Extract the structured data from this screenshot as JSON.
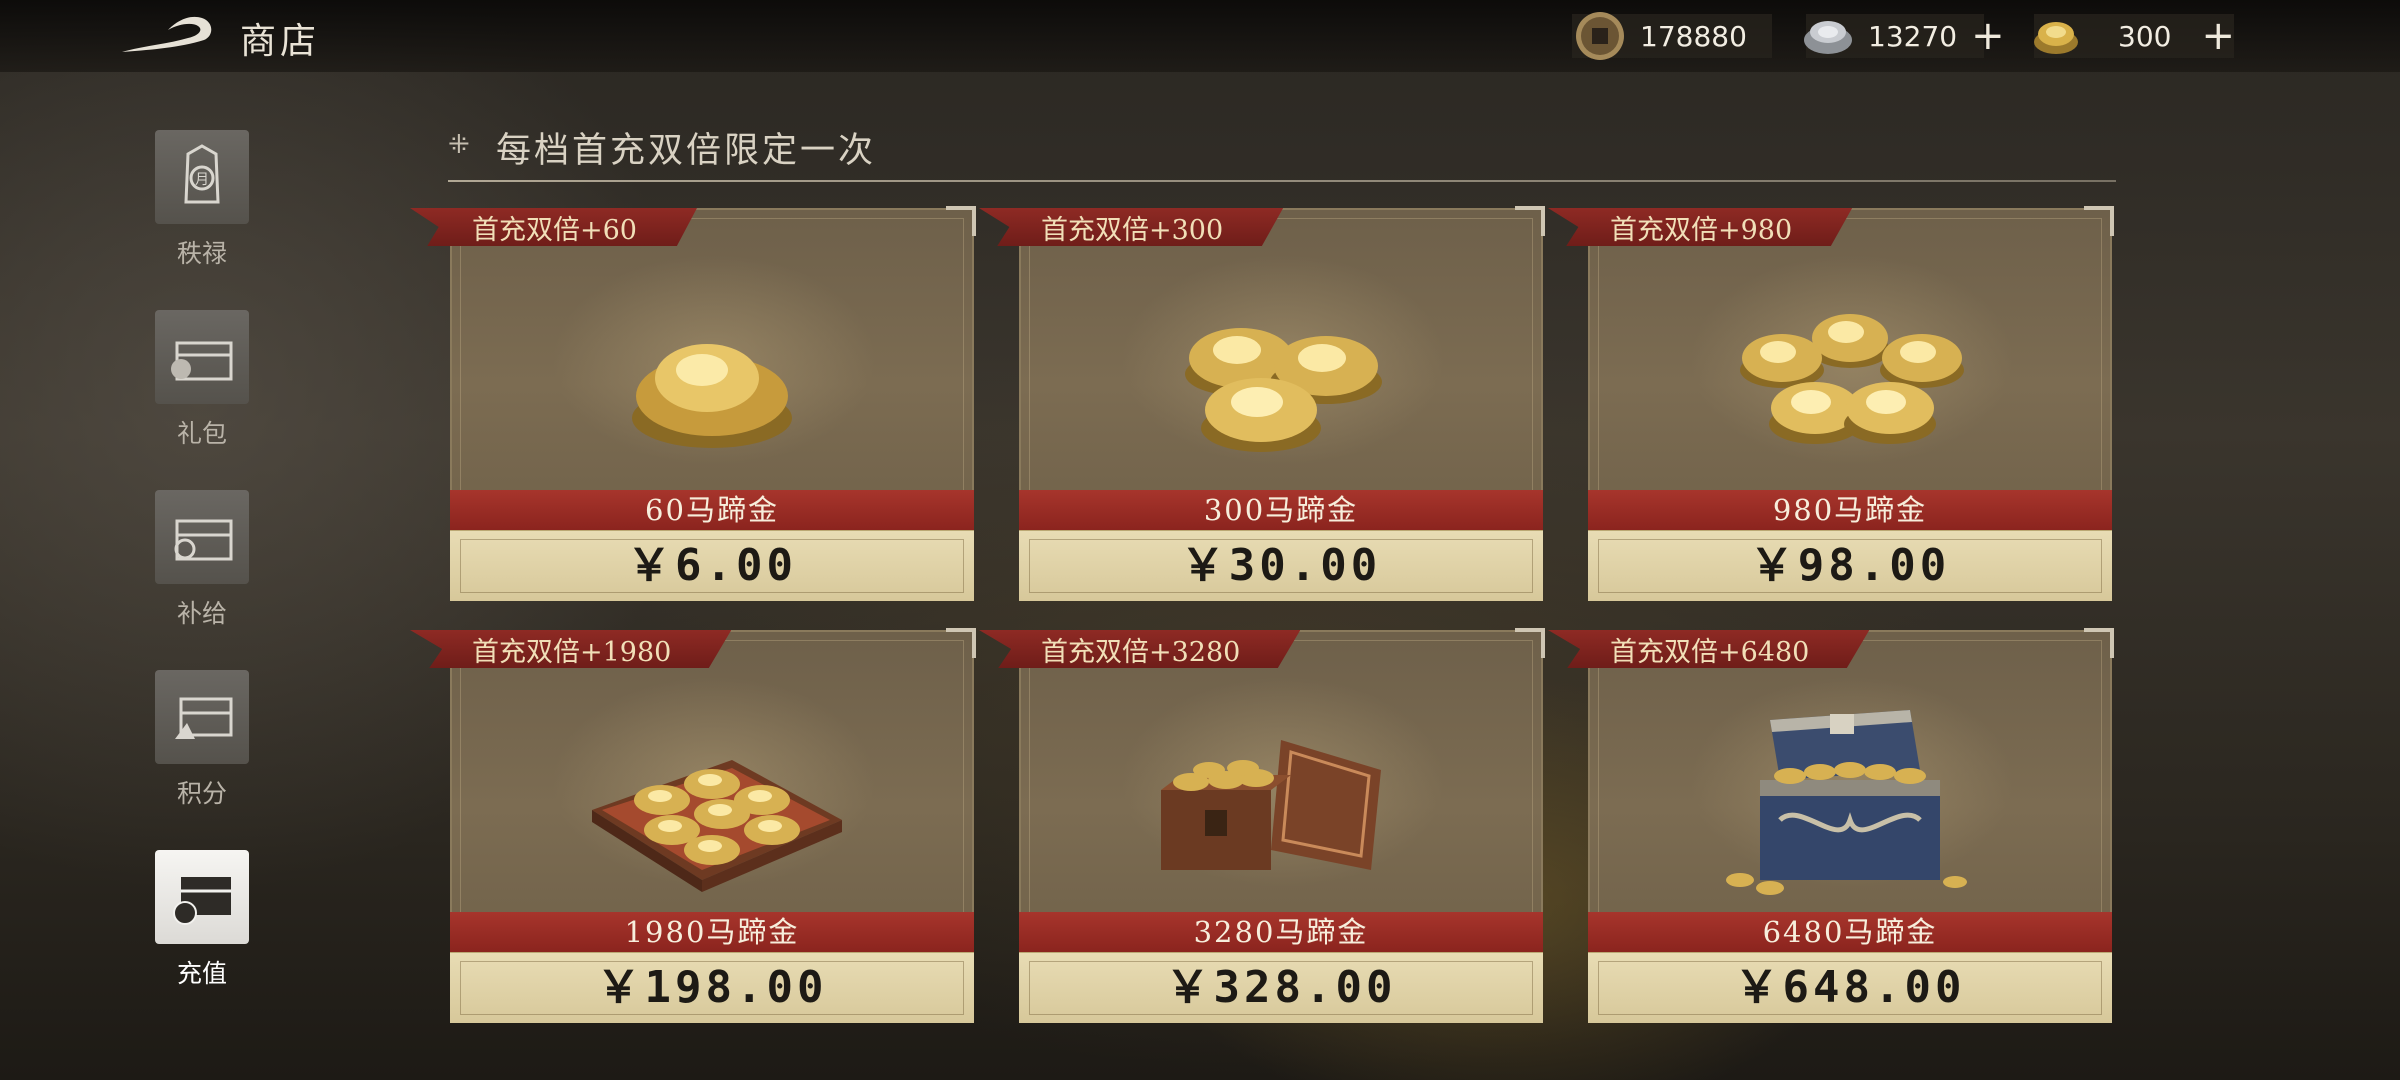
{
  "topbar": {
    "title": "商店",
    "currencies": [
      {
        "icon": "copper-coin-icon",
        "value": "178880"
      },
      {
        "icon": "silver-ingot-icon",
        "value": "13270",
        "plus": "+"
      },
      {
        "icon": "gold-horseshoe-icon",
        "value": "300",
        "plus": "+"
      }
    ]
  },
  "sidebar": {
    "items": [
      {
        "label": "秩禄",
        "icon": "salary-token-icon",
        "active": false
      },
      {
        "label": "礼包",
        "icon": "gift-chest-icon",
        "active": false
      },
      {
        "label": "补给",
        "icon": "supply-chest-icon",
        "active": false
      },
      {
        "label": "积分",
        "icon": "points-chest-icon",
        "active": false
      },
      {
        "label": "充值",
        "icon": "recharge-chest-icon",
        "active": true
      }
    ]
  },
  "notice": {
    "text": "每档首充双倍限定一次"
  },
  "cards": [
    {
      "badge": "首充双倍+60",
      "name": "60马蹄金",
      "price": "￥6.00",
      "art": "single-gold-ingot"
    },
    {
      "badge": "首充双倍+300",
      "name": "300马蹄金",
      "price": "￥30.00",
      "art": "three-gold-ingots"
    },
    {
      "badge": "首充双倍+980",
      "name": "980马蹄金",
      "price": "￥98.00",
      "art": "five-gold-ingots"
    },
    {
      "badge": "首充双倍+1980",
      "name": "1980马蹄金",
      "price": "￥198.00",
      "art": "gold-ingot-tray"
    },
    {
      "badge": "首充双倍+3280",
      "name": "3280马蹄金",
      "price": "￥328.00",
      "art": "wooden-gold-box"
    },
    {
      "badge": "首充双倍+6480",
      "name": "6480马蹄金",
      "price": "￥648.00",
      "art": "treasure-chest"
    }
  ],
  "colors": {
    "ribbon": "#8e2a24",
    "name_bar": "#a7352c",
    "price_bar": "#e3d6ac",
    "gold": "#d9b24a"
  }
}
